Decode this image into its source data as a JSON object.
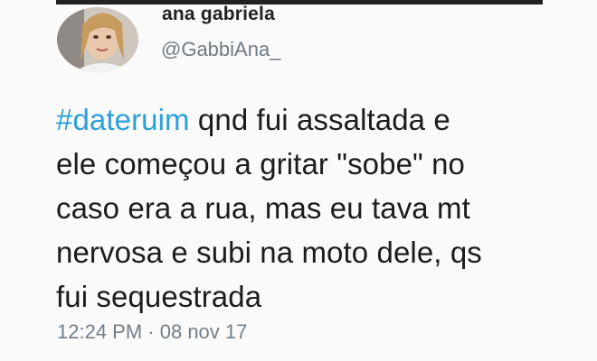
{
  "user": {
    "display_name": "ana gabriela",
    "handle": "@GabbiAna_"
  },
  "tweet": {
    "hashtag": "#dateruim",
    "lines": [
      " qnd fui assaltada e",
      "ele começou a gritar \"sobe\" no",
      "caso era a rua, mas eu tava mt",
      "nervosa e subi na moto dele, qs",
      "fui sequestrada"
    ],
    "hashtag_color": "#2a9fd8"
  },
  "meta": {
    "time": "12:24 PM",
    "separator": " · ",
    "date": "08 nov 17"
  }
}
